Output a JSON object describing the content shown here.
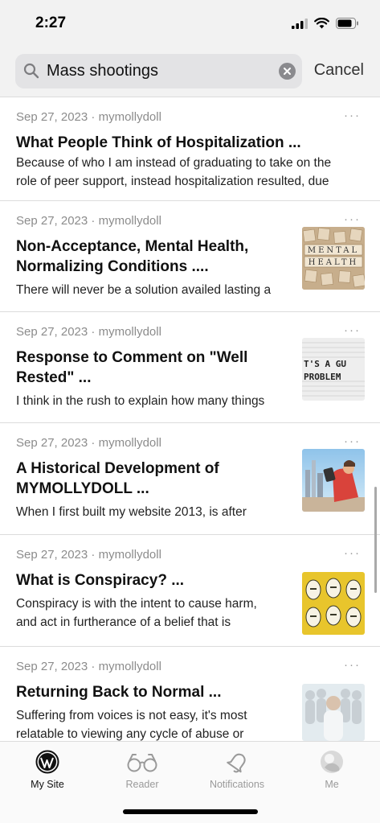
{
  "status_bar": {
    "time": "2:27"
  },
  "search": {
    "value": "Mass shootings",
    "cancel_label": "Cancel"
  },
  "posts": [
    {
      "meta": "Sep 27, 2023 · mymollydoll",
      "more": "···",
      "title": "What People Think of Hospitalization ...",
      "excerpt_lines": [
        "Because of who I am instead of graduating to take on the",
        "role of peer support, instead hospitalization resulted, due"
      ]
    },
    {
      "meta": "Sep 27, 2023 · mymollydoll",
      "more": "···",
      "title": "Non-Acceptance, Mental Health,",
      "title2": "Normalizing Conditions ....",
      "excerpt_lines": [
        "There will never be a solution availed lasting a"
      ],
      "thumb_text_1": "MENTAL",
      "thumb_text_2": "HEALTH"
    },
    {
      "meta": "Sep 27, 2023 · mymollydoll",
      "more": "···",
      "title": "Response to Comment on \"Well",
      "title2": "Rested\" ...",
      "excerpt_lines": [
        "I think in the rush to explain how many things"
      ],
      "thumb_text_1": "T'S A GU",
      "thumb_text_2": "PROBLEM"
    },
    {
      "meta": "Sep 27, 2023 · mymollydoll",
      "more": "···",
      "title": "A Historical Development of",
      "title2": "MYMOLLYDOLL ...",
      "excerpt_lines": [
        "When I first built my website 2013, is after"
      ]
    },
    {
      "meta": "Sep 27, 2023 · mymollydoll",
      "more": "···",
      "title": "What is Conspiracy? ...",
      "excerpt_lines": [
        "Conspiracy is with the intent to cause harm,",
        "and act in furtherance of a belief that is"
      ]
    },
    {
      "meta": "Sep 27, 2023 · mymollydoll",
      "more": "···",
      "title": "Returning Back to Normal ...",
      "excerpt_lines": [
        "Suffering from voices is not easy, it's most",
        "relatable to viewing any cycle of abuse or"
      ]
    }
  ],
  "tabs": [
    {
      "label": "My Site",
      "icon": "wordpress-icon",
      "active": true
    },
    {
      "label": "Reader",
      "icon": "glasses-icon",
      "active": false
    },
    {
      "label": "Notifications",
      "icon": "bell-icon",
      "active": false
    },
    {
      "label": "Me",
      "icon": "avatar-icon",
      "active": false
    }
  ],
  "colors": {
    "accent": "#111111",
    "muted": "#8c8c8c",
    "search_bg": "#e3e3e5",
    "header_bg": "#f2f2f2"
  }
}
